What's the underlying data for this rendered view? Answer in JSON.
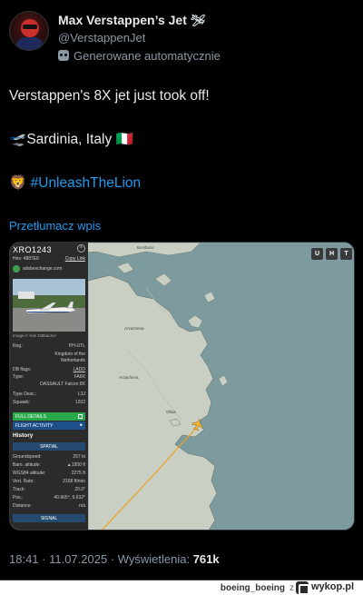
{
  "author": {
    "name": "Max Verstappen’s Jet",
    "name_badge": "🛩",
    "handle": "@VerstappenJet",
    "automated_label": "Generowane automatycznie"
  },
  "tweet": {
    "line1": "Verstappen's 8X jet just took off!",
    "line2_emoji": "🛫",
    "line2_text": "Sardinia, Italy",
    "line2_flag": "🇮🇹",
    "line3_emoji": "🦁",
    "hashtag": "#UnleashTheLion"
  },
  "translate_label": "Przetłumacz wpis",
  "panel": {
    "callsign": "XRO1243",
    "close": "×",
    "reg_line": "Hex: 4887E6",
    "copy_link": "Copy Link",
    "site": "adsbexchange.com",
    "photo_credit": "Image © Kari Dittbacher",
    "reg_label": "Reg.:",
    "reg_value": "PH-UTL",
    "country_line1": "Kingdom of the",
    "country_line2": "Netherlands",
    "dbflags_label": "DB flags:",
    "dbflags_value": "LADD",
    "type_label": "Type:",
    "type_value": "FA8X",
    "type_full": "DASSAULT Falcon 8X",
    "typedesc_label": "Type Desc.:",
    "typedesc_value": "L3J",
    "squawk_label": "Squawk:",
    "squawk_value": "1202",
    "full_details": "FULL DETAILS",
    "flight_activity": "FLIGHT ACTIVITY",
    "flight_activity_arrow": "▸",
    "history": "History",
    "spatial": "SPATIAL",
    "gs_label": "Groundspeed:",
    "gs_value": "257 kt",
    "baro_label": "Baro. altitude:",
    "baro_value": "▲1950 ft",
    "wgs_label": "WGS84 altitude:",
    "wgs_value": "2275 ft",
    "vr_label": "Vert. Rate:",
    "vr_value": "2168 ft/min",
    "track_label": "Track:",
    "track_value": "20.0°",
    "pos_label": "Pos.:",
    "pos_value": "40.965°, 9.632°",
    "dist_label": "Distance:",
    "dist_value": "n/a",
    "signal": "SIGNAL"
  },
  "map_buttons": [
    "U",
    "H",
    "T"
  ],
  "map_labels": {
    "north": "Bonifacio",
    "arzachena": "Arzachena",
    "arzachena2": "Arzachena",
    "olbia": "Olbia"
  },
  "meta": {
    "time": "18:41 · 11.07.2025 · Wyświetlenia: ",
    "views": "761k"
  },
  "footer": {
    "user": "boeing_boeing",
    "z": "z",
    "brand": "wykop.pl"
  },
  "colors": {
    "sea": "#7d9b9e",
    "land": "#c9cfc2",
    "accent_blue": "#1d9bf0",
    "track": "#f0a020"
  }
}
